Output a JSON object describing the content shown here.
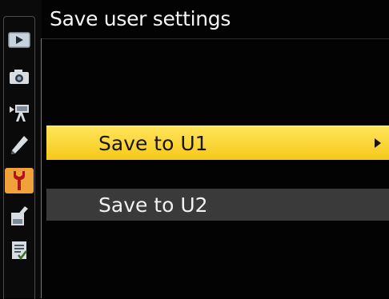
{
  "screen": {
    "title": "Save user settings"
  },
  "sidebar": {
    "tabs": [
      {
        "icon": "playback-icon"
      },
      {
        "icon": "camera-icon"
      },
      {
        "icon": "movie-camera-icon"
      },
      {
        "icon": "pencil-icon"
      },
      {
        "icon": "wrench-icon",
        "active": true
      },
      {
        "icon": "retouch-icon"
      },
      {
        "icon": "my-menu-icon"
      }
    ]
  },
  "menu": {
    "items": [
      {
        "label": "Save to U1",
        "selected": true,
        "submenu_arrow": true
      },
      {
        "label": "Save to U2",
        "selected": false
      }
    ]
  },
  "colors": {
    "selected_row": "#f6c81b",
    "active_tab": "#f0a23a",
    "normal_row": "#3a3a3a"
  }
}
